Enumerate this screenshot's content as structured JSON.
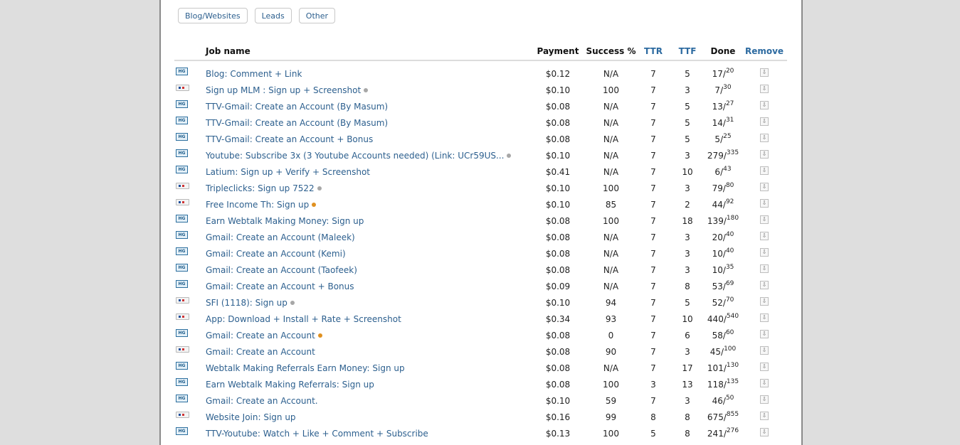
{
  "filters": [
    "Blog/Websites",
    "Leads",
    "Other"
  ],
  "columns": {
    "job_name": "Job name",
    "payment": "Payment",
    "success": "Success %",
    "ttr": "TTR",
    "ttf": "TTF",
    "done": "Done",
    "remove": "Remove"
  },
  "icons": {
    "hg_text": "HG",
    "remove_glyph": "⇩"
  },
  "colors": {
    "link": "#2c5f8e",
    "header_link": "#2c6aa0",
    "status_grey": "#a7a7a7",
    "status_orange": "#e09020"
  },
  "jobs": [
    {
      "icon": "hg",
      "name": "Blog: Comment + Link",
      "status": "",
      "payment": "$0.12",
      "success": "N/A",
      "ttr": "7",
      "ttf": "5",
      "done": "17",
      "total": "20"
    },
    {
      "icon": "flag",
      "name": "Sign up MLM : Sign up + Screenshot",
      "status": "grey",
      "payment": "$0.10",
      "success": "100",
      "ttr": "7",
      "ttf": "3",
      "done": "7",
      "total": "30"
    },
    {
      "icon": "hg",
      "name": "TTV-Gmail: Create an Account (By Masum)",
      "status": "",
      "payment": "$0.08",
      "success": "N/A",
      "ttr": "7",
      "ttf": "5",
      "done": "13",
      "total": "27"
    },
    {
      "icon": "hg",
      "name": "TTV-Gmail: Create an Account (By Masum)",
      "status": "",
      "payment": "$0.08",
      "success": "N/A",
      "ttr": "7",
      "ttf": "5",
      "done": "14",
      "total": "31"
    },
    {
      "icon": "hg",
      "name": "TTV-Gmail: Create an Account + Bonus",
      "status": "",
      "payment": "$0.08",
      "success": "N/A",
      "ttr": "7",
      "ttf": "5",
      "done": "5",
      "total": "25"
    },
    {
      "icon": "hg",
      "name": "Youtube: Subscribe 3x (3 Youtube Accounts needed) (Link: UCr59US...",
      "status": "grey",
      "payment": "$0.10",
      "success": "N/A",
      "ttr": "7",
      "ttf": "3",
      "done": "279",
      "total": "335"
    },
    {
      "icon": "hg",
      "name": "Latium: Sign up + Verify + Screenshot",
      "status": "",
      "payment": "$0.41",
      "success": "N/A",
      "ttr": "7",
      "ttf": "10",
      "done": "6",
      "total": "43"
    },
    {
      "icon": "flag",
      "name": "Tripleclicks: Sign up 7522",
      "status": "grey",
      "payment": "$0.10",
      "success": "100",
      "ttr": "7",
      "ttf": "3",
      "done": "79",
      "total": "80"
    },
    {
      "icon": "flag",
      "name": "Free Income Th: Sign up",
      "status": "orange",
      "payment": "$0.10",
      "success": "85",
      "ttr": "7",
      "ttf": "2",
      "done": "44",
      "total": "92"
    },
    {
      "icon": "hg",
      "name": "Earn Webtalk Making Money: Sign up",
      "status": "",
      "payment": "$0.08",
      "success": "100",
      "ttr": "7",
      "ttf": "18",
      "done": "139",
      "total": "180"
    },
    {
      "icon": "hg",
      "name": "Gmail: Create an Account (Maleek)",
      "status": "",
      "payment": "$0.08",
      "success": "N/A",
      "ttr": "7",
      "ttf": "3",
      "done": "20",
      "total": "40"
    },
    {
      "icon": "hg",
      "name": "Gmail: Create an Account (Kemi)",
      "status": "",
      "payment": "$0.08",
      "success": "N/A",
      "ttr": "7",
      "ttf": "3",
      "done": "10",
      "total": "40"
    },
    {
      "icon": "hg",
      "name": "Gmail: Create an Account (Taofeek)",
      "status": "",
      "payment": "$0.08",
      "success": "N/A",
      "ttr": "7",
      "ttf": "3",
      "done": "10",
      "total": "35"
    },
    {
      "icon": "hg",
      "name": "Gmail: Create an Account + Bonus",
      "status": "",
      "payment": "$0.09",
      "success": "N/A",
      "ttr": "7",
      "ttf": "8",
      "done": "53",
      "total": "69"
    },
    {
      "icon": "flag",
      "name": "SFI (1118): Sign up",
      "status": "grey",
      "payment": "$0.10",
      "success": "94",
      "ttr": "7",
      "ttf": "5",
      "done": "52",
      "total": "70"
    },
    {
      "icon": "flag",
      "name": "App: Download + Install + Rate + Screenshot",
      "status": "",
      "payment": "$0.34",
      "success": "93",
      "ttr": "7",
      "ttf": "10",
      "done": "440",
      "total": "540"
    },
    {
      "icon": "hg",
      "name": "Gmail: Create an Account",
      "status": "orange",
      "payment": "$0.08",
      "success": "0",
      "ttr": "7",
      "ttf": "6",
      "done": "58",
      "total": "60"
    },
    {
      "icon": "flag",
      "name": "Gmail: Create an Account",
      "status": "",
      "payment": "$0.08",
      "success": "90",
      "ttr": "7",
      "ttf": "3",
      "done": "45",
      "total": "100"
    },
    {
      "icon": "hg",
      "name": "Webtalk Making Referrals Earn Money: Sign up",
      "status": "",
      "payment": "$0.08",
      "success": "N/A",
      "ttr": "7",
      "ttf": "17",
      "done": "101",
      "total": "130"
    },
    {
      "icon": "hg",
      "name": "Earn Webtalk Making Referrals: Sign up",
      "status": "",
      "payment": "$0.08",
      "success": "100",
      "ttr": "3",
      "ttf": "13",
      "done": "118",
      "total": "135"
    },
    {
      "icon": "hg",
      "name": "Gmail: Create an Account.",
      "status": "",
      "payment": "$0.10",
      "success": "59",
      "ttr": "7",
      "ttf": "3",
      "done": "46",
      "total": "50"
    },
    {
      "icon": "flag",
      "name": "Website Join: Sign up",
      "status": "",
      "payment": "$0.16",
      "success": "99",
      "ttr": "8",
      "ttf": "8",
      "done": "675",
      "total": "855"
    },
    {
      "icon": "hg",
      "name": "TTV-Youtube: Watch + Like + Comment + Subscribe",
      "status": "",
      "payment": "$0.13",
      "success": "100",
      "ttr": "5",
      "ttf": "8",
      "done": "241",
      "total": "276"
    }
  ]
}
